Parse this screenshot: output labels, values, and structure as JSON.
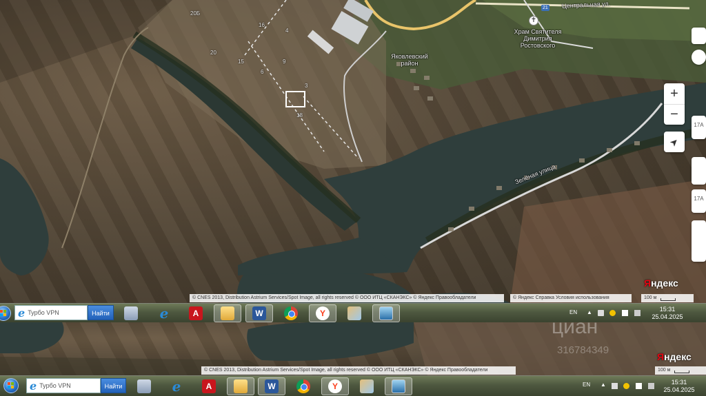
{
  "map": {
    "labels": {
      "district": "Яковлевский район",
      "church": "Храм Святителя Димитрия Ростовского",
      "street_top": "Центральная ул.",
      "street_bottom": "Зелёная улица",
      "road_number": "21"
    },
    "parcel_numbers": [
      "20Б",
      "20",
      "15",
      "6",
      "18",
      "9",
      "3",
      "16",
      "4"
    ],
    "edge_marks": [
      "17А",
      "17А"
    ],
    "controls": {
      "zoom_in": "+",
      "zoom_out": "−",
      "locate": "➤"
    },
    "logo": {
      "first_letter": "Я",
      "rest": "ндекс"
    },
    "copyright_main": "© CNES 2013, Distribution Astrium Services/Spot Image, all rights reserved © ООО ИТЦ «СКАНЭКС» © Яндекс  Правообладатели",
    "copyright_secondary": "© Яндекс  Справка  Условия использования",
    "scale_label": "100 м",
    "watermark": "циан",
    "watermark_digits": "316784349"
  },
  "taskbar": {
    "search_placeholder": "Турбо VPN",
    "search_button": "Найти",
    "apps": [
      "calculator-icon",
      "ie-icon",
      "pdf-icon",
      "folder-icon",
      "word-icon",
      "chrome-icon",
      "yandex-browser-icon",
      "paint-icon",
      "photo-viewer-icon"
    ],
    "language": "EN",
    "time": "15:31",
    "date": "25.04.2025"
  },
  "colors": {
    "water": "#2f3e3c",
    "field": "#4e4233",
    "taskbar": "#4e5840",
    "accent": "#2a72c8"
  }
}
